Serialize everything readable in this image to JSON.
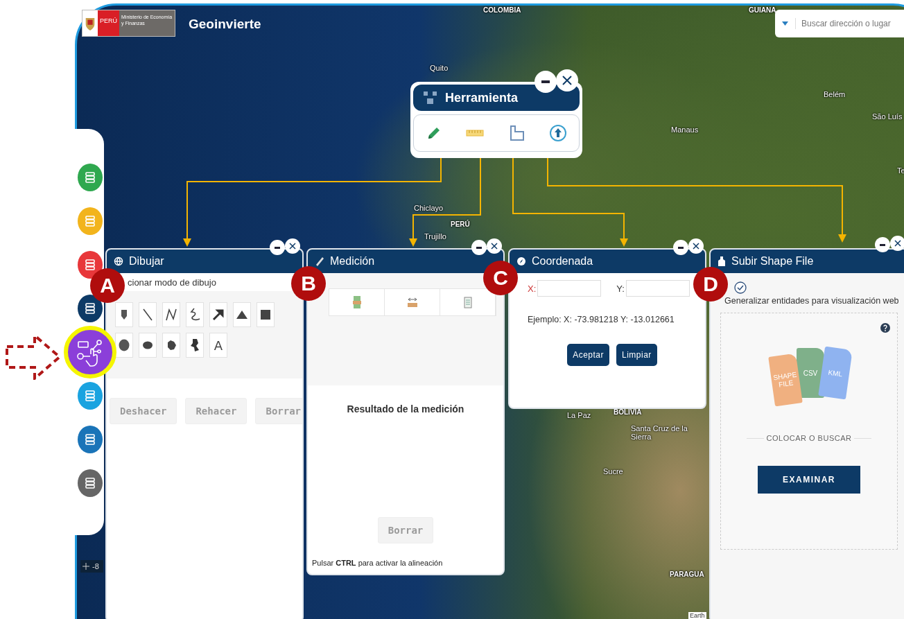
{
  "header": {
    "country": "PERÚ",
    "ministry": "Ministerio de Economía y Finanzas",
    "app_name": "Geoinvierte"
  },
  "search": {
    "placeholder": "Buscar dirección o lugar"
  },
  "map_labels": [
    {
      "text": "COLOMBIA",
      "kind": "country"
    },
    {
      "text": "GUIANA",
      "kind": "country"
    },
    {
      "text": "Quito",
      "kind": "city"
    },
    {
      "text": "Belém",
      "kind": "city"
    },
    {
      "text": "São Luís",
      "kind": "city"
    },
    {
      "text": "Manaus",
      "kind": "city"
    },
    {
      "text": "Chiclayo",
      "kind": "city"
    },
    {
      "text": "PERÚ",
      "kind": "country"
    },
    {
      "text": "Trujillo",
      "kind": "city"
    },
    {
      "text": "La Paz",
      "kind": "city"
    },
    {
      "text": "BOLIVIA",
      "kind": "country"
    },
    {
      "text": "Santa Cruz de la Sierra",
      "kind": "city"
    },
    {
      "text": "Sucre",
      "kind": "city"
    },
    {
      "text": "PARAGUA",
      "kind": "country"
    },
    {
      "text": "Te",
      "kind": "city"
    },
    {
      "text": "Earth",
      "kind": "credit"
    }
  ],
  "sidebar": {
    "items": [
      {
        "color": "#2fa84f",
        "selected": false
      },
      {
        "color": "#f2b41c",
        "selected": false
      },
      {
        "color": "#e8373a",
        "selected": false
      },
      {
        "color": "#0d3a66",
        "selected": false
      },
      {
        "color": "#8b3fd9",
        "selected": true
      },
      {
        "color": "#1aa3e0",
        "selected": false
      },
      {
        "color": "#1a74b8",
        "selected": false
      },
      {
        "color": "#666666",
        "selected": false
      }
    ]
  },
  "coordinate_readout": "-8",
  "toolbox": {
    "title": "Herramienta"
  },
  "draw_panel": {
    "badge": "A",
    "title": "Dibujar",
    "instruction": "cionar modo de dibujo",
    "text_tool": "A",
    "buttons": [
      {
        "label": "Deshacer",
        "disabled": true
      },
      {
        "label": "Rehacer",
        "disabled": true
      },
      {
        "label": "Borrar",
        "disabled": true
      }
    ]
  },
  "measure_panel": {
    "badge": "B",
    "title": "Medición",
    "result_title": "Resultado de la medición",
    "button": {
      "label": "Borrar",
      "disabled": true
    },
    "hint": "Pulsar **CTRL** para activar la alineación"
  },
  "coordinate_panel": {
    "badge": "C",
    "title": "Coordenada",
    "x_label": "X:",
    "y_label": "Y:",
    "example": "Ejemplo: X: -73.981218 Y: -13.012661",
    "buttons": [
      "Aceptar",
      "Limpiar"
    ]
  },
  "upload_panel": {
    "badge": "D",
    "title": "Subir Shape File",
    "generalize": {
      "label": "Generalizar entidades para visualización web",
      "checked": true
    },
    "file_types": [
      {
        "label": "SHAPE FILE",
        "color": "#f0b080"
      },
      {
        "label": "CSV",
        "color": "#7fb08a"
      },
      {
        "label": "KML",
        "color": "#8fb3f0"
      }
    ],
    "drop_text": "COLOCAR O BUSCAR",
    "button": "EXAMINAR"
  }
}
